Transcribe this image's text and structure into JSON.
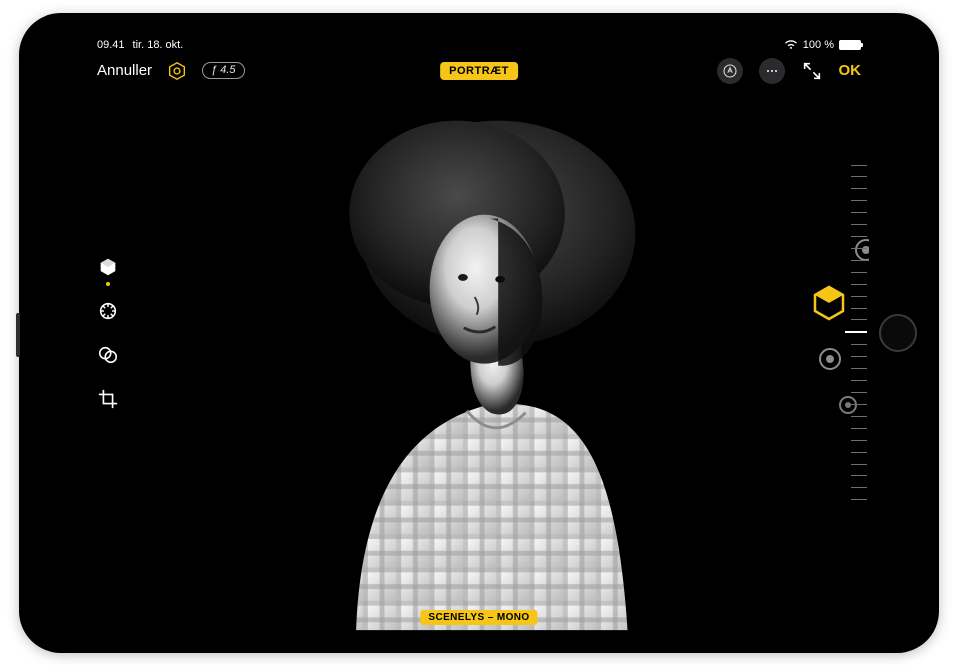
{
  "status": {
    "time": "09.41",
    "date": "tir. 18. okt.",
    "battery_pct": "100 %"
  },
  "topbar": {
    "cancel": "Annuller",
    "fstop": "ƒ 4.5",
    "mode": "PORTRÆT",
    "ok": "OK"
  },
  "canvas": {
    "lighting_label": "SCENELYS – MONO"
  },
  "accent": "#f5c518"
}
